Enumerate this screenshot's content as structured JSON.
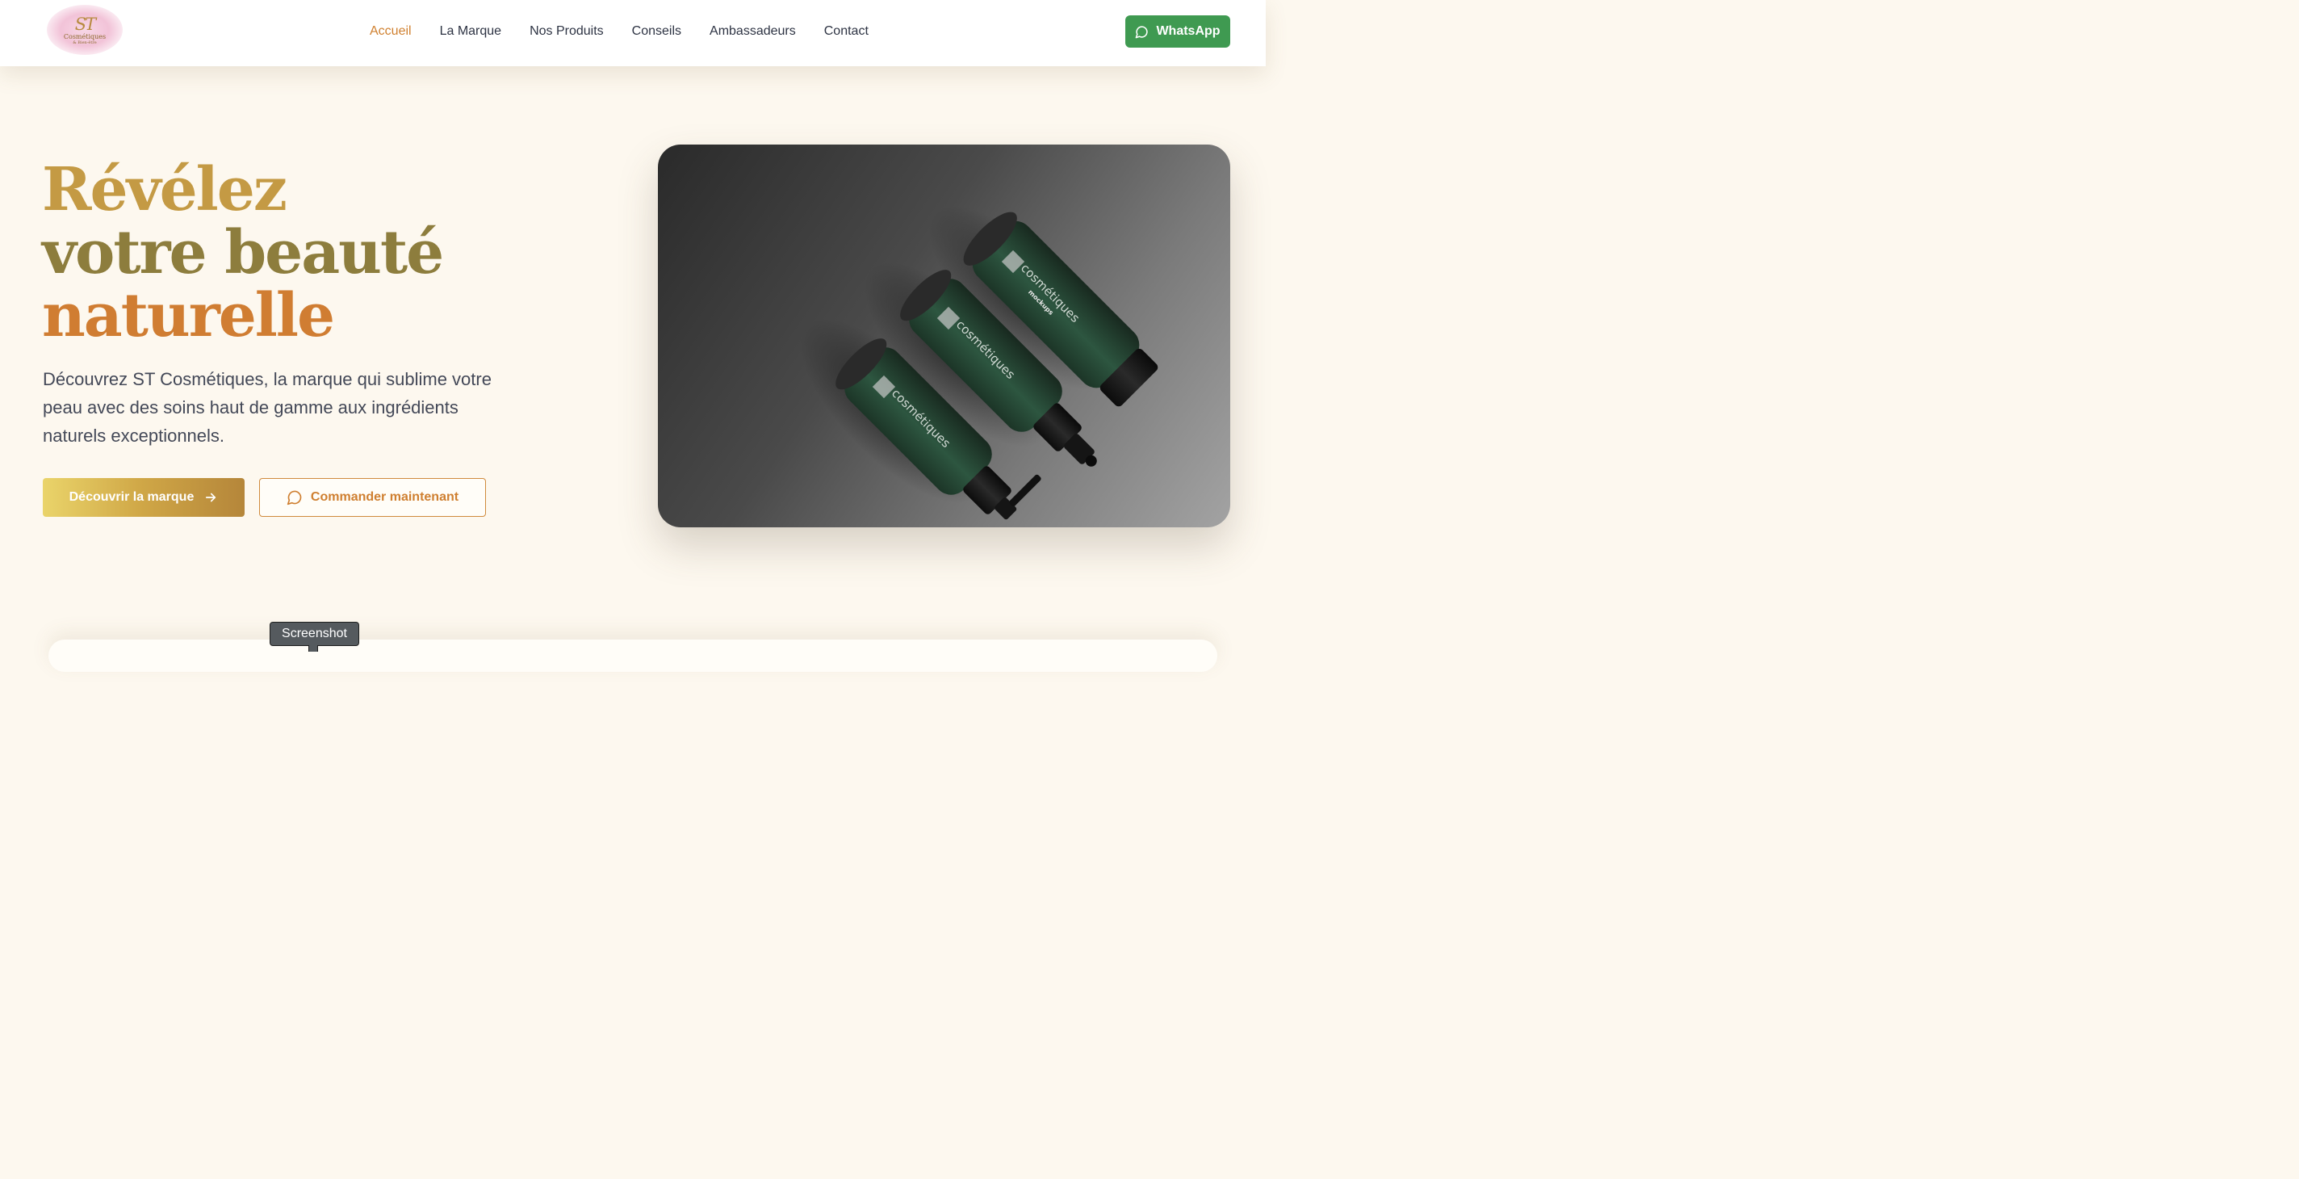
{
  "header": {
    "logo": {
      "monogram": "ST",
      "name": "Cosmétiques",
      "tagline": "& Bien-être"
    },
    "nav": [
      {
        "label": "Accueil",
        "active": true
      },
      {
        "label": "La Marque",
        "active": false
      },
      {
        "label": "Nos Produits",
        "active": false
      },
      {
        "label": "Conseils",
        "active": false
      },
      {
        "label": "Ambassadeurs",
        "active": false
      },
      {
        "label": "Contact",
        "active": false
      }
    ],
    "whatsapp_label": "WhatsApp"
  },
  "hero": {
    "title_line1": "Révélez",
    "title_line2": "votre beauté",
    "title_line3": "naturelle",
    "subtitle": "Découvrez ST Cosmétiques, la marque qui sublime votre peau avec des soins haut de gamme aux ingrédients naturels exceptionnels.",
    "primary_button": "Découvrir la marque",
    "secondary_button": "Commander maintenant",
    "product_text": "cosmétiques",
    "product_subtext": "mockups"
  },
  "tooltip": "Screenshot",
  "colors": {
    "accent_orange": "#d0802f",
    "gold": "#c49a44",
    "olive": "#8d7d3d",
    "whatsapp_green": "#3f9a51",
    "background": "#fdf8ef",
    "bottle_green": "#244634"
  },
  "icons": {
    "whatsapp": "chat-bubble-icon",
    "primary_button": "arrow-right-icon",
    "secondary_button": "chat-bubble-icon"
  }
}
